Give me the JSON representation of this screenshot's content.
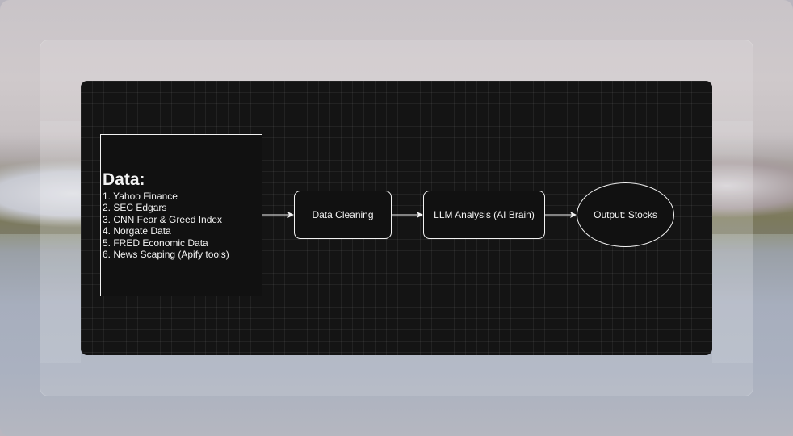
{
  "diagram": {
    "data_source": {
      "title": "Data:",
      "items": [
        "1. Yahoo Finance",
        "2. SEC Edgars",
        "3. CNN Fear & Greed Index",
        "4. Norgate Data",
        "5. FRED Economic Data",
        "6. News Scaping (Apify tools)"
      ]
    },
    "steps": {
      "cleaning": "Data Cleaning",
      "llm": "LLM Analysis (AI Brain)",
      "output": "Output: Stocks"
    },
    "edges": [
      {
        "from": "data_source",
        "to": "cleaning"
      },
      {
        "from": "cleaning",
        "to": "llm"
      },
      {
        "from": "llm",
        "to": "output"
      }
    ],
    "colors": {
      "canvas": "#141414",
      "stroke": "#f2f2f2",
      "text": "#f2f2f2"
    }
  }
}
